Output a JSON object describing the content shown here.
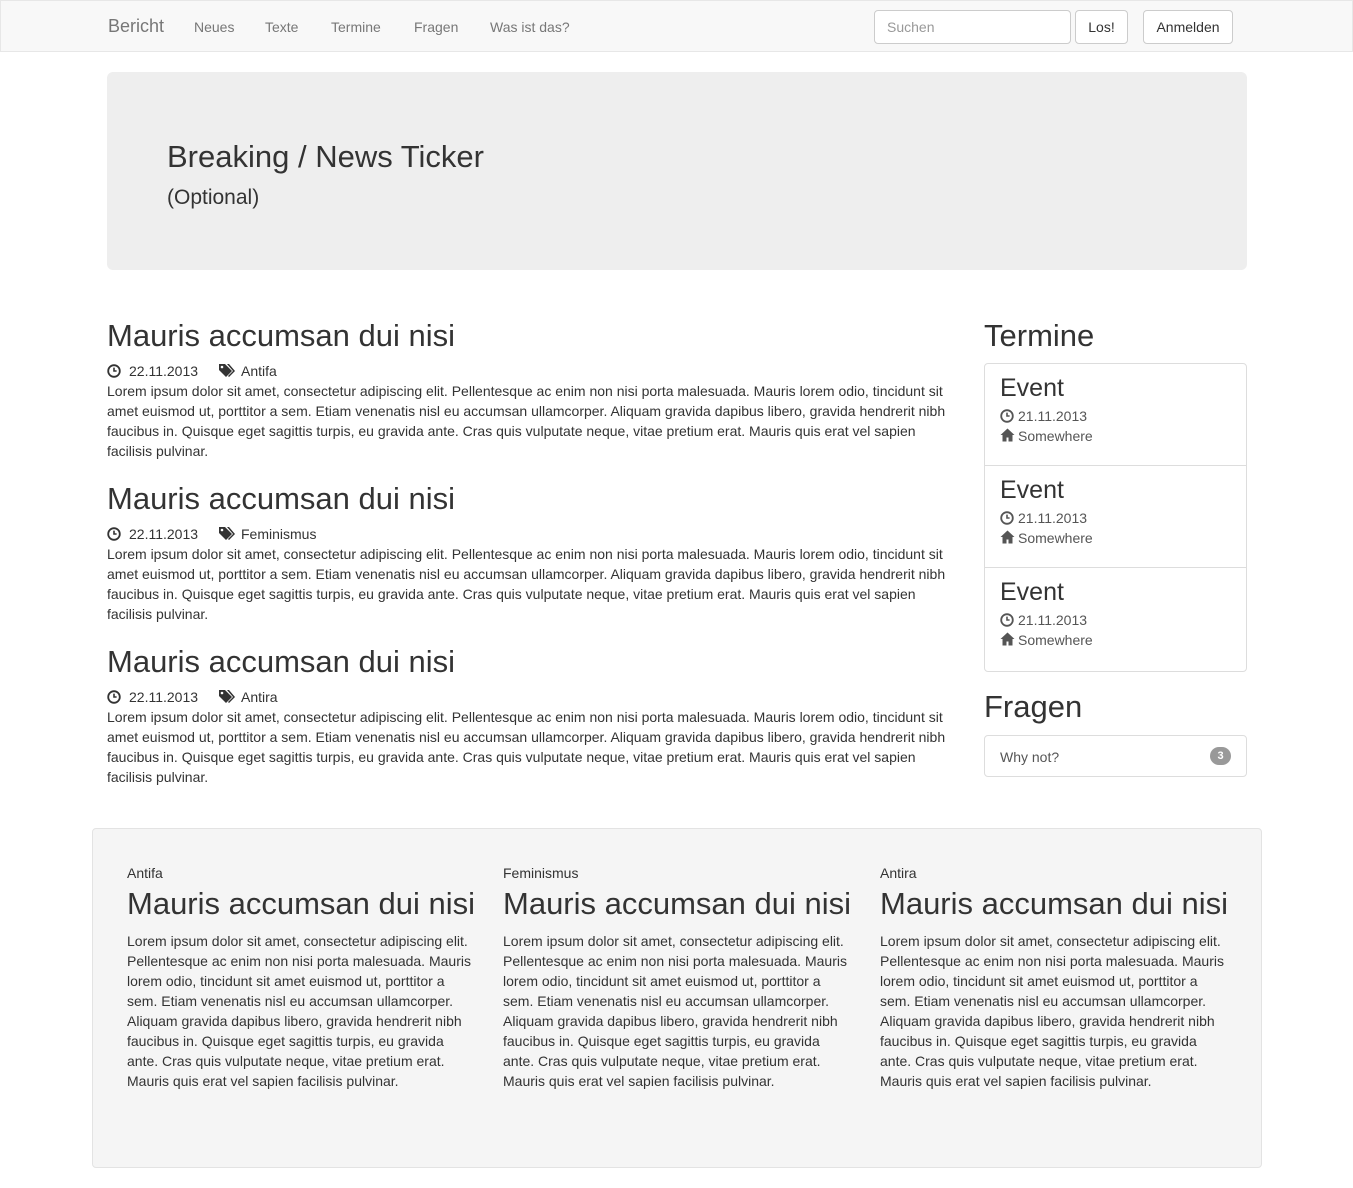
{
  "navbar": {
    "brand": "Bericht",
    "links": [
      "Neues",
      "Texte",
      "Termine",
      "Fragen",
      "Was ist das?"
    ],
    "search_placeholder": "Suchen",
    "search_button": "Los!",
    "login_button": "Anmelden"
  },
  "jumbotron": {
    "title": "Breaking / News Ticker",
    "subtitle": "(Optional)"
  },
  "articles": [
    {
      "title": "Mauris accumsan dui nisi",
      "date": "22.11.2013",
      "tag": "Antifa",
      "body": "Lorem ipsum dolor sit amet, consectetur adipiscing elit. Pellentesque ac enim non nisi porta malesuada. Mauris lorem odio, tincidunt sit amet euismod ut, porttitor a sem. Etiam venenatis nisl eu accumsan ullamcorper. Aliquam gravida dapibus libero, gravida hendrerit nibh faucibus in. Quisque eget sagittis turpis, eu gravida ante. Cras quis vulputate neque, vitae pretium erat. Mauris quis erat vel sapien facilisis pulvinar."
    },
    {
      "title": "Mauris accumsan dui nisi",
      "date": "22.11.2013",
      "tag": "Feminismus",
      "body": "Lorem ipsum dolor sit amet, consectetur adipiscing elit. Pellentesque ac enim non nisi porta malesuada. Mauris lorem odio, tincidunt sit amet euismod ut, porttitor a sem. Etiam venenatis nisl eu accumsan ullamcorper. Aliquam gravida dapibus libero, gravida hendrerit nibh faucibus in. Quisque eget sagittis turpis, eu gravida ante. Cras quis vulputate neque, vitae pretium erat. Mauris quis erat vel sapien facilisis pulvinar."
    },
    {
      "title": "Mauris accumsan dui nisi",
      "date": "22.11.2013",
      "tag": "Antira",
      "body": "Lorem ipsum dolor sit amet, consectetur adipiscing elit. Pellentesque ac enim non nisi porta malesuada. Mauris lorem odio, tincidunt sit amet euismod ut, porttitor a sem. Etiam venenatis nisl eu accumsan ullamcorper. Aliquam gravida dapibus libero, gravida hendrerit nibh faucibus in. Quisque eget sagittis turpis, eu gravida ante. Cras quis vulputate neque, vitae pretium erat. Mauris quis erat vel sapien facilisis pulvinar."
    }
  ],
  "sidebar": {
    "termine_title": "Termine",
    "events": [
      {
        "title": "Event",
        "date": "21.11.2013",
        "location": "Somewhere"
      },
      {
        "title": "Event",
        "date": "21.11.2013",
        "location": "Somewhere"
      },
      {
        "title": "Event",
        "date": "21.11.2013",
        "location": "Somewhere"
      }
    ],
    "fragen_title": "Fragen",
    "questions": [
      {
        "label": "Why not?",
        "count": "3"
      }
    ]
  },
  "footer": {
    "columns": [
      {
        "category": "Antifa",
        "title": "Mauris accumsan dui nisi",
        "body": "Lorem ipsum dolor sit amet, consectetur adipiscing elit. Pellentesque ac enim non nisi porta malesuada. Mauris lorem odio, tincidunt sit amet euismod ut, porttitor a sem. Etiam venenatis nisl eu accumsan ullamcorper. Aliquam gravida dapibus libero, gravida hendrerit nibh faucibus in. Quisque eget sagittis turpis, eu gravida ante. Cras quis vulputate neque, vitae pretium erat. Mauris quis erat vel sapien facilisis pulvinar."
      },
      {
        "category": "Feminismus",
        "title": "Mauris accumsan dui nisi",
        "body": "Lorem ipsum dolor sit amet, consectetur adipiscing elit. Pellentesque ac enim non nisi porta malesuada. Mauris lorem odio, tincidunt sit amet euismod ut, porttitor a sem. Etiam venenatis nisl eu accumsan ullamcorper. Aliquam gravida dapibus libero, gravida hendrerit nibh faucibus in. Quisque eget sagittis turpis, eu gravida ante. Cras quis vulputate neque, vitae pretium erat. Mauris quis erat vel sapien facilisis pulvinar."
      },
      {
        "category": "Antira",
        "title": "Mauris accumsan dui nisi",
        "body": "Lorem ipsum dolor sit amet, consectetur adipiscing elit. Pellentesque ac enim non nisi porta malesuada. Mauris lorem odio, tincidunt sit amet euismod ut, porttitor a sem. Etiam venenatis nisl eu accumsan ullamcorper. Aliquam gravida dapibus libero, gravida hendrerit nibh faucibus in. Quisque eget sagittis turpis, eu gravida ante. Cras quis vulputate neque, vitae pretium erat. Mauris quis erat vel sapien facilisis pulvinar."
      }
    ]
  },
  "icons": {
    "date": "clock-icon",
    "tag": "tags-icon",
    "location": "home-icon"
  },
  "colors": {
    "navbar_bg": "#f8f8f8",
    "jumbotron_bg": "#eeeeee",
    "well_bg": "#f5f5f5",
    "badge_bg": "#999999",
    "text": "#333333",
    "muted": "#777777"
  }
}
